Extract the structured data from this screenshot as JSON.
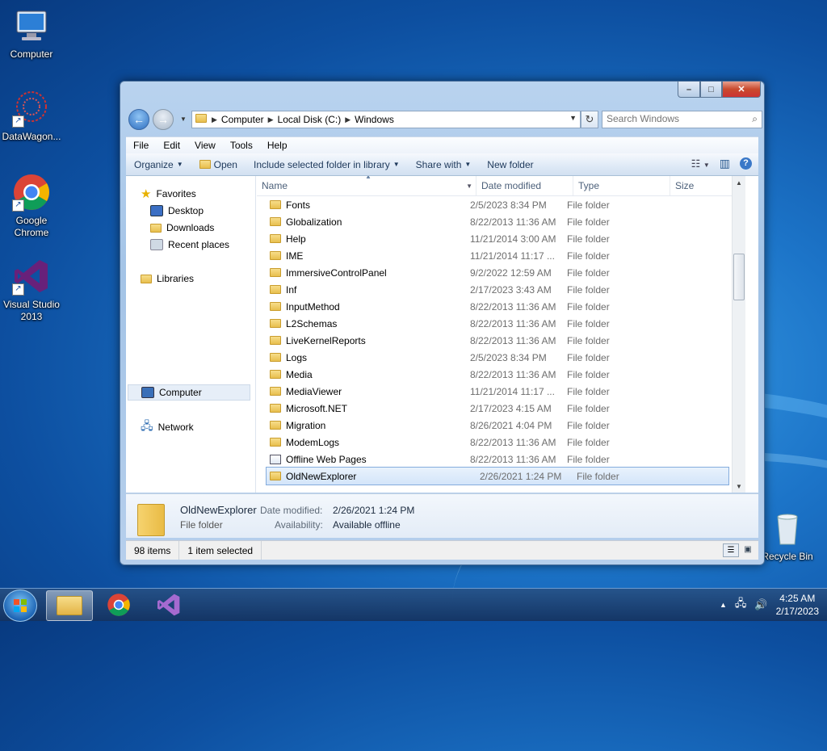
{
  "desktop": {
    "icons": [
      {
        "label": "Computer"
      },
      {
        "label": "DataWagon..."
      },
      {
        "label": "Google Chrome"
      },
      {
        "label": "Visual Studio 2013"
      },
      {
        "label": "Recycle Bin"
      }
    ]
  },
  "window": {
    "breadcrumb": [
      "Computer",
      "Local Disk (C:)",
      "Windows"
    ],
    "search_placeholder": "Search Windows",
    "menu": [
      "File",
      "Edit",
      "View",
      "Tools",
      "Help"
    ],
    "commands": {
      "organize": "Organize",
      "open": "Open",
      "include": "Include selected folder in library",
      "share": "Share with",
      "new_folder": "New folder"
    },
    "nav": {
      "favorites": "Favorites",
      "desktop": "Desktop",
      "downloads": "Downloads",
      "recent": "Recent places",
      "libraries": "Libraries",
      "computer": "Computer",
      "network": "Network"
    },
    "columns": {
      "name": "Name",
      "date": "Date modified",
      "type": "Type",
      "size": "Size"
    },
    "files": [
      {
        "name": "Fonts",
        "date": "2/5/2023 8:34 PM",
        "type": "File folder"
      },
      {
        "name": "Globalization",
        "date": "8/22/2013 11:36 AM",
        "type": "File folder"
      },
      {
        "name": "Help",
        "date": "11/21/2014 3:00 AM",
        "type": "File folder"
      },
      {
        "name": "IME",
        "date": "11/21/2014 11:17 ...",
        "type": "File folder"
      },
      {
        "name": "ImmersiveControlPanel",
        "date": "9/2/2022 12:59 AM",
        "type": "File folder"
      },
      {
        "name": "Inf",
        "date": "2/17/2023 3:43 AM",
        "type": "File folder"
      },
      {
        "name": "InputMethod",
        "date": "8/22/2013 11:36 AM",
        "type": "File folder"
      },
      {
        "name": "L2Schemas",
        "date": "8/22/2013 11:36 AM",
        "type": "File folder"
      },
      {
        "name": "LiveKernelReports",
        "date": "8/22/2013 11:36 AM",
        "type": "File folder"
      },
      {
        "name": "Logs",
        "date": "2/5/2023 8:34 PM",
        "type": "File folder"
      },
      {
        "name": "Media",
        "date": "8/22/2013 11:36 AM",
        "type": "File folder"
      },
      {
        "name": "MediaViewer",
        "date": "11/21/2014 11:17 ...",
        "type": "File folder"
      },
      {
        "name": "Microsoft.NET",
        "date": "2/17/2023 4:15 AM",
        "type": "File folder"
      },
      {
        "name": "Migration",
        "date": "8/26/2021 4:04 PM",
        "type": "File folder"
      },
      {
        "name": "ModemLogs",
        "date": "8/22/2013 11:36 AM",
        "type": "File folder"
      },
      {
        "name": "Offline Web Pages",
        "date": "8/22/2013 11:36 AM",
        "type": "File folder"
      },
      {
        "name": "OldNewExplorer",
        "date": "2/26/2021 1:24 PM",
        "type": "File folder"
      }
    ],
    "details": {
      "name": "OldNewExplorer",
      "type": "File folder",
      "date_label": "Date modified:",
      "date_value": "2/26/2021 1:24 PM",
      "avail_label": "Availability:",
      "avail_value": "Available offline"
    },
    "status": {
      "items": "98 items",
      "selected": "1 item selected"
    }
  },
  "taskbar": {
    "time": "4:25 AM",
    "date": "2/17/2023"
  }
}
